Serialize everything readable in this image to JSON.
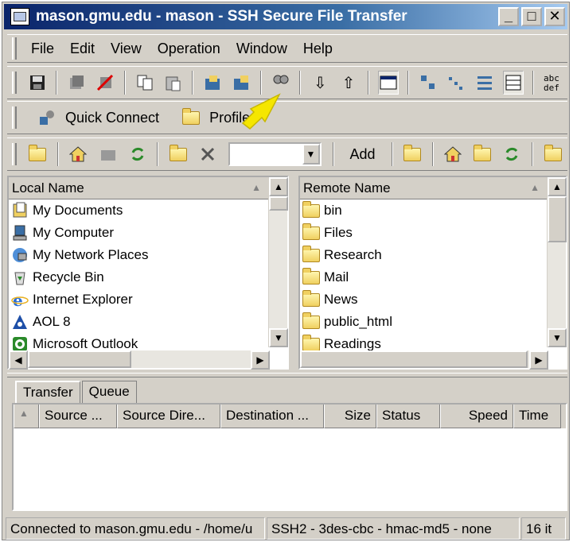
{
  "window": {
    "title": "mason.gmu.edu - mason - SSH Secure File Transfer"
  },
  "menu": [
    {
      "label": "File"
    },
    {
      "label": "Edit"
    },
    {
      "label": "View"
    },
    {
      "label": "Operation"
    },
    {
      "label": "Window"
    },
    {
      "label": "Help"
    }
  ],
  "quickbar": {
    "quick_connect": "Quick Connect",
    "profiles": "Profiles"
  },
  "nav": {
    "add_label": "Add",
    "path_value": ""
  },
  "local": {
    "header": "Local Name",
    "items": [
      {
        "label": "My Documents",
        "icon": "my-documents-icon"
      },
      {
        "label": "My  Computer",
        "icon": "my-computer-icon"
      },
      {
        "label": "My Network Places",
        "icon": "network-places-icon"
      },
      {
        "label": "Recycle Bin",
        "icon": "recycle-bin-icon"
      },
      {
        "label": "Internet Explorer",
        "icon": "internet-explorer-icon"
      },
      {
        "label": "AOL 8",
        "icon": "aol-icon"
      },
      {
        "label": "Microsoft Outlook",
        "icon": "outlook-icon"
      }
    ]
  },
  "remote": {
    "header": "Remote Name",
    "items": [
      {
        "label": "bin"
      },
      {
        "label": "Files"
      },
      {
        "label": "Research"
      },
      {
        "label": "Mail"
      },
      {
        "label": "News"
      },
      {
        "label": "public_html"
      },
      {
        "label": "Readings"
      }
    ]
  },
  "tabs": [
    {
      "label": "Transfer"
    },
    {
      "label": "Queue"
    }
  ],
  "transfer_columns": [
    "Source ...",
    "Source Dire...",
    "Destination ...",
    "Size",
    "Status",
    "Speed",
    "Time"
  ],
  "status": {
    "connection": "Connected to mason.gmu.edu - /home/u",
    "cipher": "SSH2 - 3des-cbc - hmac-md5 - none",
    "count": "16 it"
  },
  "colors": {
    "titlebar_start": "#0a246a",
    "titlebar_end": "#a6caf0",
    "annotation_arrow": "#f5e600"
  }
}
